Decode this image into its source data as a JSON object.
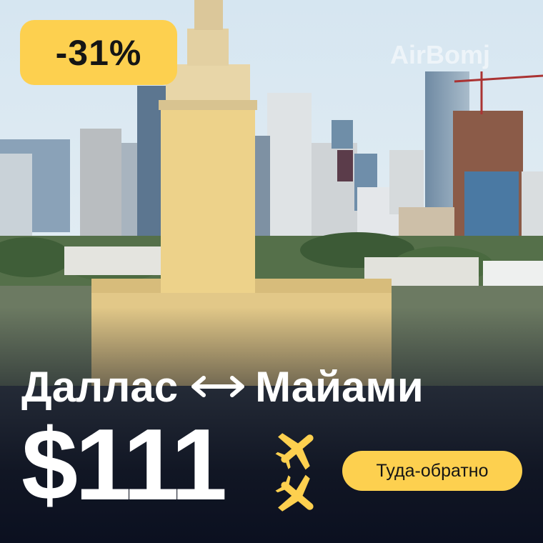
{
  "promo": {
    "discount": "-31%",
    "watermark": "AirBomj",
    "origin": "Даллас",
    "destination": "Майами",
    "price": "$111",
    "trip_type": "Туда-обратно"
  },
  "icons": {
    "route_arrow": "double-arrow-icon",
    "planes": "airplane-icon"
  },
  "colors": {
    "accent": "#fdd04f",
    "text": "#ffffff",
    "badge_text": "#151515",
    "overlay": "#0d1220"
  }
}
